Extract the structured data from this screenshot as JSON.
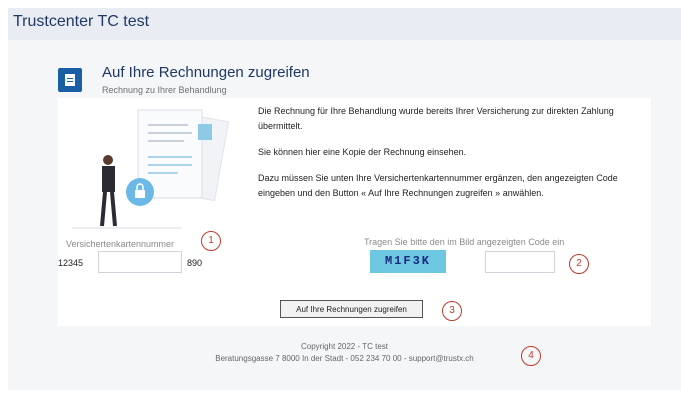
{
  "header": {
    "title": "Trustcenter TC test"
  },
  "section": {
    "icon": "document-icon",
    "title": "Auf Ihre Rechnungen zugreifen",
    "subtitle": "Rechnung zu Ihrer Behandlung"
  },
  "info": {
    "p1": "Die Rechnung für Ihre Behandlung wurde bereits Ihrer Versicherung zur direkten Zahlung übermittelt.",
    "p2": "Sie können hier eine Kopie der Rechnung einsehen.",
    "p3": "Dazu müssen Sie unten Ihre Versichertenkartennummer ergänzen, den angezeigten Code eingeben und den Button « Auf Ihre Rechnungen zugreifen » anwählen."
  },
  "form": {
    "card_label": "Versichertenkartennummer",
    "card_prefix": "12345",
    "card_input_value": "",
    "card_suffix": "890",
    "code_label": "Tragen Sie bitte den im Bild angezeigten Code ein",
    "captcha_text": "M1F3K",
    "code_input_value": "",
    "submit_label": "Auf Ihre Rechnungen zugreifen"
  },
  "footer": {
    "copyright": "Copyright 2022 - TC test",
    "address": "Beratungsgasse 7 8000 In der Stadt - 052 234 70 00 - support@trustx.ch"
  },
  "markers": [
    "1",
    "2",
    "3",
    "4"
  ],
  "colors": {
    "accent": "#1a5fa3",
    "title": "#1f3864",
    "marker": "#c0392b",
    "captcha_bg": "#6ec7e0"
  }
}
